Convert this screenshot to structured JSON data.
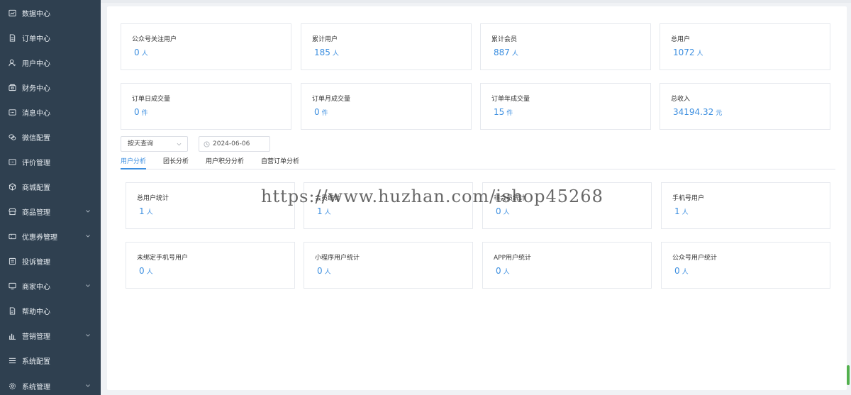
{
  "sidebar": {
    "items": [
      {
        "label": "数据中心",
        "icon": "monitor-chart-icon",
        "has_chevron": false
      },
      {
        "label": "订单中心",
        "icon": "document-icon",
        "has_chevron": false
      },
      {
        "label": "用户中心",
        "icon": "user-icon",
        "has_chevron": false
      },
      {
        "label": "财务中心",
        "icon": "wallet-icon",
        "has_chevron": false
      },
      {
        "label": "消息中心",
        "icon": "message-icon",
        "has_chevron": false
      },
      {
        "label": "微信配置",
        "icon": "wechat-icon",
        "has_chevron": false
      },
      {
        "label": "评价管理",
        "icon": "comment-icon",
        "has_chevron": false
      },
      {
        "label": "商城配置",
        "icon": "cube-icon",
        "has_chevron": false
      },
      {
        "label": "商品管理",
        "icon": "store-icon",
        "has_chevron": true
      },
      {
        "label": "优惠券管理",
        "icon": "coupon-icon",
        "has_chevron": true
      },
      {
        "label": "投诉管理",
        "icon": "complaint-icon",
        "has_chevron": false
      },
      {
        "label": "商家中心",
        "icon": "screen-icon",
        "has_chevron": true
      },
      {
        "label": "帮助中心",
        "icon": "help-doc-icon",
        "has_chevron": false
      },
      {
        "label": "营销管理",
        "icon": "bar-chart-icon",
        "has_chevron": true
      },
      {
        "label": "系统配置",
        "icon": "menu-lines-icon",
        "has_chevron": false
      },
      {
        "label": "系统管理",
        "icon": "settings-icon",
        "has_chevron": true
      }
    ]
  },
  "summary_row1": [
    {
      "label": "公众号关注用户",
      "value": "0",
      "unit": "人"
    },
    {
      "label": "累计用户",
      "value": "185",
      "unit": "人"
    },
    {
      "label": "累计会员",
      "value": "887",
      "unit": "人"
    },
    {
      "label": "总用户",
      "value": "1072",
      "unit": "人"
    }
  ],
  "summary_row2": [
    {
      "label": "订单日成交量",
      "value": "0",
      "unit": "件"
    },
    {
      "label": "订单月成交量",
      "value": "0",
      "unit": "件"
    },
    {
      "label": "订单年成交量",
      "value": "15",
      "unit": "件"
    },
    {
      "label": "总收入",
      "value": "34194.32",
      "unit": "元"
    }
  ],
  "filter": {
    "query_mode": "按天查询",
    "date": "2024-06-06"
  },
  "tabs": [
    {
      "label": "用户分析",
      "active": true
    },
    {
      "label": "团长分析",
      "active": false
    },
    {
      "label": "用户积分分析",
      "active": false
    },
    {
      "label": "自营订单分析",
      "active": false
    }
  ],
  "user_row1": [
    {
      "label": "总用户统计",
      "value": "1",
      "unit": "人"
    },
    {
      "label": "会员统计",
      "value": "1",
      "unit": "人"
    },
    {
      "label": "非会员统计",
      "value": "0",
      "unit": "人"
    },
    {
      "label": "手机号用户",
      "value": "1",
      "unit": "人"
    }
  ],
  "user_row2": [
    {
      "label": "未绑定手机号用户",
      "value": "0",
      "unit": "人"
    },
    {
      "label": "小程序用户统计",
      "value": "0",
      "unit": "人"
    },
    {
      "label": "APP用户统计",
      "value": "0",
      "unit": "人"
    },
    {
      "label": "公众号用户统计",
      "value": "0",
      "unit": "人"
    }
  ],
  "watermark": "https://www.huzhan.com/ishop45268",
  "colors": {
    "sidebar_bg": "#2f4050",
    "accent": "#3d8fe0",
    "scrollbar": "#52b04d"
  }
}
